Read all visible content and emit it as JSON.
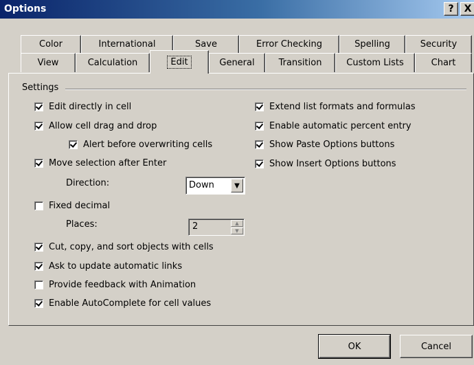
{
  "window": {
    "title": "Options",
    "help_glyph": "?",
    "close_glyph": "X"
  },
  "tabs_row1": [
    "Color",
    "International",
    "Save",
    "Error Checking",
    "Spelling",
    "Security"
  ],
  "tabs_row2": [
    "View",
    "Calculation",
    "Edit",
    "General",
    "Transition",
    "Custom Lists",
    "Chart"
  ],
  "active_tab": "Edit",
  "settings": {
    "group_label": "Settings",
    "edit_directly": "Edit directly in cell",
    "drag_drop": "Allow cell drag and drop",
    "alert_overwrite": "Alert before overwriting cells",
    "move_selection": "Move selection after Enter",
    "direction_label": "Direction:",
    "direction_value": "Down",
    "fixed_decimal": "Fixed decimal",
    "places_label": "Places:",
    "places_value": "2",
    "cut_copy": "Cut, copy, and sort objects with cells",
    "ask_update": "Ask to update automatic links",
    "feedback_animation": "Provide feedback with Animation",
    "autocomplete": "Enable AutoComplete for cell values",
    "extend_list": "Extend list formats and formulas",
    "percent_entry": "Enable automatic percent entry",
    "paste_options": "Show Paste Options buttons",
    "insert_options": "Show Insert Options buttons"
  },
  "checked": {
    "edit_directly": true,
    "drag_drop": true,
    "alert_overwrite": true,
    "move_selection": true,
    "fixed_decimal": false,
    "cut_copy": true,
    "ask_update": true,
    "feedback_animation": false,
    "autocomplete": true,
    "extend_list": true,
    "percent_entry": true,
    "paste_options": true,
    "insert_options": true
  },
  "buttons": {
    "ok": "OK",
    "cancel": "Cancel"
  },
  "icons": {
    "checkbox": "check-icon",
    "dropdown": "chevron-down-icon",
    "spin_up": "triangle-up-icon",
    "spin_down": "triangle-down-icon"
  }
}
